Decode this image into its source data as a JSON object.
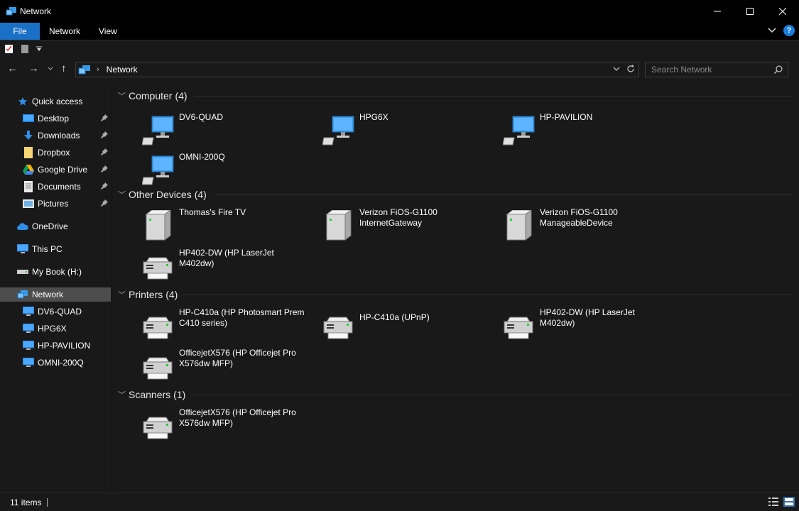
{
  "window": {
    "title": "Network"
  },
  "ribbon": {
    "tabs": [
      "File",
      "Network",
      "View"
    ]
  },
  "address": {
    "crumb": "Network",
    "search_placeholder": "Search Network"
  },
  "sidebar": {
    "quick_access": "Quick access",
    "pinned": [
      "Desktop",
      "Downloads",
      "Dropbox",
      "Google Drive",
      "Documents",
      "Pictures"
    ],
    "onedrive": "OneDrive",
    "this_pc": "This PC",
    "mybook": "My Book (H:)",
    "network": "Network",
    "network_children": [
      "DV6-QUAD",
      "HPG6X",
      "HP-PAVILION",
      "OMNI-200Q"
    ]
  },
  "groups": [
    {
      "title": "Computer",
      "count": "(4)",
      "icon": "computer-icon",
      "items": [
        "DV6-QUAD",
        "HPG6X",
        "HP-PAVILION",
        "OMNI-200Q"
      ]
    },
    {
      "title": "Other Devices",
      "count": "(4)",
      "icon": "device-icon",
      "items": [
        "Thomas's Fire TV",
        "Verizon FiOS-G1100 InternetGateway",
        "Verizon FiOS-G1100 ManageableDevice",
        "HP402-DW (HP LaserJet M402dw)"
      ]
    },
    {
      "title": "Printers",
      "count": "(4)",
      "icon": "printer-icon",
      "items": [
        "HP-C410a (HP Photosmart Prem C410 series)",
        "HP-C410a (UPnP)",
        "HP402-DW (HP LaserJet M402dw)",
        "OfficejetX576 (HP Officejet Pro X576dw MFP)"
      ]
    },
    {
      "title": "Scanners",
      "count": "(1)",
      "icon": "scanner-icon",
      "items": [
        "OfficejetX576 (HP Officejet Pro X576dw MFP)"
      ]
    }
  ],
  "status": {
    "item_count": "11 items"
  },
  "colors": {
    "accent": "#1a6fc6",
    "background": "#191919",
    "selected": "#4d4d4d"
  }
}
